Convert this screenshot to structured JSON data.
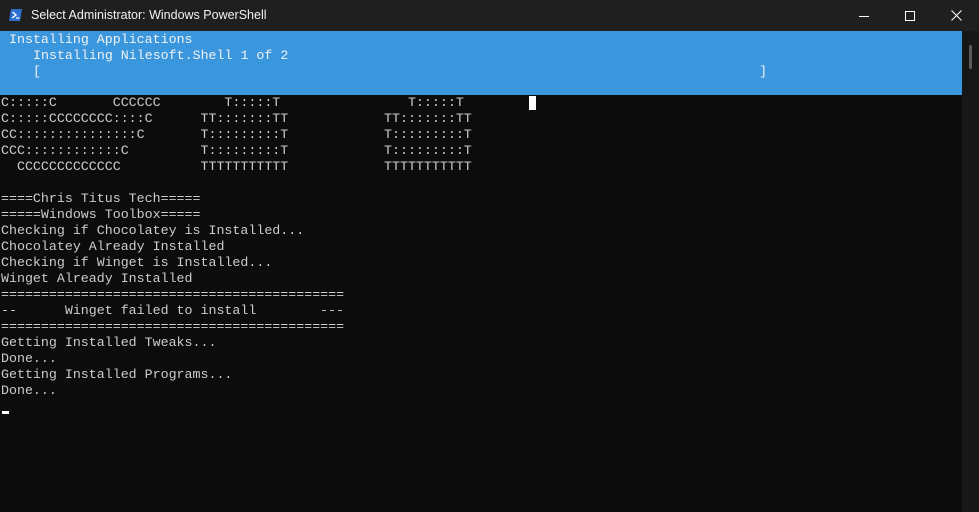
{
  "window": {
    "title": "Select Administrator: Windows PowerShell",
    "app_icon": "powershell-icon",
    "controls": [
      "minimize-icon",
      "maximize-icon",
      "close-icon"
    ]
  },
  "progress": {
    "activity": "Installing Applications",
    "status": "Installing Nilesoft.Shell 1 of 2",
    "bar": "[                                                                                          ]"
  },
  "ascii_logo": [
    "C:::::C       CCCCCC        T:::::T                T:::::T",
    "C:::::CCCCCCCC::::C      TT:::::::TT            TT:::::::TT",
    "CC:::::::::::::::C       T:::::::::T            T:::::::::T",
    "CCC::::::::::::C         T:::::::::T            T:::::::::T",
    "  CCCCCCCCCCCCC          TTTTTTTTTTT            TTTTTTTTTTT"
  ],
  "output_lines": [
    "====Chris Titus Tech=====",
    "=====Windows Toolbox=====",
    "Checking if Chocolatey is Installed...",
    "Chocolatey Already Installed",
    "Checking if Winget is Installed...",
    "Winget Already Installed",
    "===========================================",
    "--      Winget failed to install        ---",
    "===========================================",
    "Getting Installed Tweaks...",
    "Done...",
    "Getting Installed Programs...",
    "Done..."
  ],
  "colors": {
    "terminal_bg": "#0c0c0c",
    "titlebar_bg": "#1f1f1f",
    "progress_bg": "#3a96dd",
    "text": "#cccccc"
  }
}
